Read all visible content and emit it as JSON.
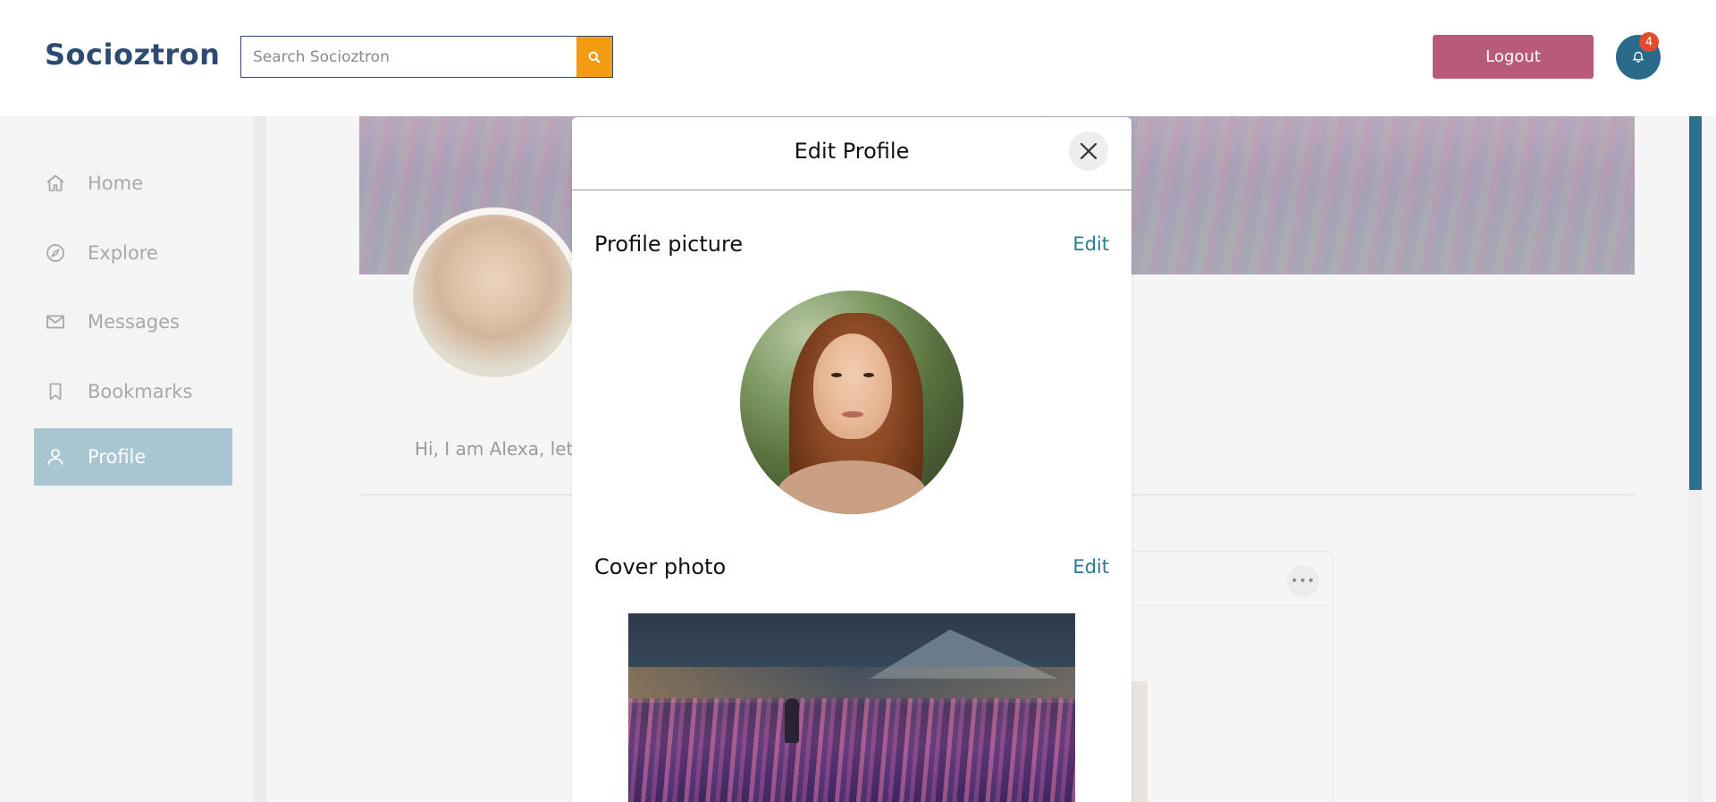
{
  "app": {
    "name": "Socioztron"
  },
  "header": {
    "search": {
      "placeholder": "Search Socioztron",
      "value": ""
    },
    "logout_label": "Logout",
    "notifications_count": "4"
  },
  "sidebar": {
    "items": [
      {
        "label": "Home",
        "icon": "home-icon",
        "active": false
      },
      {
        "label": "Explore",
        "icon": "compass-icon",
        "active": false
      },
      {
        "label": "Messages",
        "icon": "mail-icon",
        "active": false
      },
      {
        "label": "Bookmarks",
        "icon": "bookmark-icon",
        "active": false
      },
      {
        "label": "Profile",
        "icon": "user-icon",
        "active": true
      }
    ]
  },
  "profile": {
    "bio_visible": "Hi, I am Alexa, let'"
  },
  "modal": {
    "title": "Edit Profile",
    "profile_picture": {
      "title": "Profile picture",
      "edit_label": "Edit"
    },
    "cover_photo": {
      "title": "Cover photo",
      "edit_label": "Edit"
    }
  },
  "colors": {
    "brand": "#2d4a72",
    "search_button": "#f39c12",
    "logout": "#b85b7a",
    "bell": "#2a6a8a",
    "badge": "#e24b2e",
    "active_nav": "#a9c5d1",
    "link": "#2a7a96"
  }
}
